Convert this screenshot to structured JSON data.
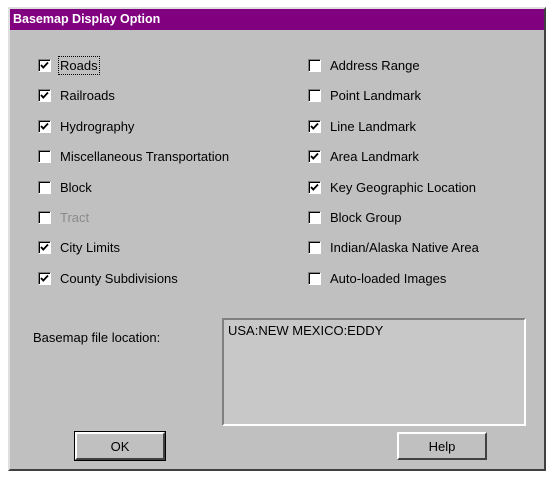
{
  "dialog": {
    "title": "Basemap Display Option",
    "title_bar_color": "#800080"
  },
  "options_left": [
    {
      "label": "Roads",
      "checked": true,
      "enabled": true,
      "focused": true
    },
    {
      "label": "Railroads",
      "checked": true,
      "enabled": true
    },
    {
      "label": "Hydrography",
      "checked": true,
      "enabled": true
    },
    {
      "label": "Miscellaneous Transportation",
      "checked": false,
      "enabled": true
    },
    {
      "label": "Block",
      "checked": false,
      "enabled": true
    },
    {
      "label": "Tract",
      "checked": false,
      "enabled": false
    },
    {
      "label": "City Limits",
      "checked": true,
      "enabled": true
    },
    {
      "label": "County Subdivisions",
      "checked": true,
      "enabled": true
    }
  ],
  "options_right": [
    {
      "label": "Address Range",
      "checked": false,
      "enabled": true
    },
    {
      "label": "Point Landmark",
      "checked": false,
      "enabled": true
    },
    {
      "label": "Line Landmark",
      "checked": true,
      "enabled": true
    },
    {
      "label": "Area Landmark",
      "checked": true,
      "enabled": true
    },
    {
      "label": "Key Geographic Location",
      "checked": true,
      "enabled": true
    },
    {
      "label": "Block Group",
      "checked": false,
      "enabled": true
    },
    {
      "label": "Indian/Alaska Native Area",
      "checked": false,
      "enabled": true
    },
    {
      "label": "Auto-loaded Images",
      "checked": false,
      "enabled": true
    }
  ],
  "basemap_location": {
    "label": "Basemap file location:",
    "value": "USA:NEW MEXICO:EDDY"
  },
  "buttons": {
    "ok": "OK",
    "help": "Help"
  }
}
